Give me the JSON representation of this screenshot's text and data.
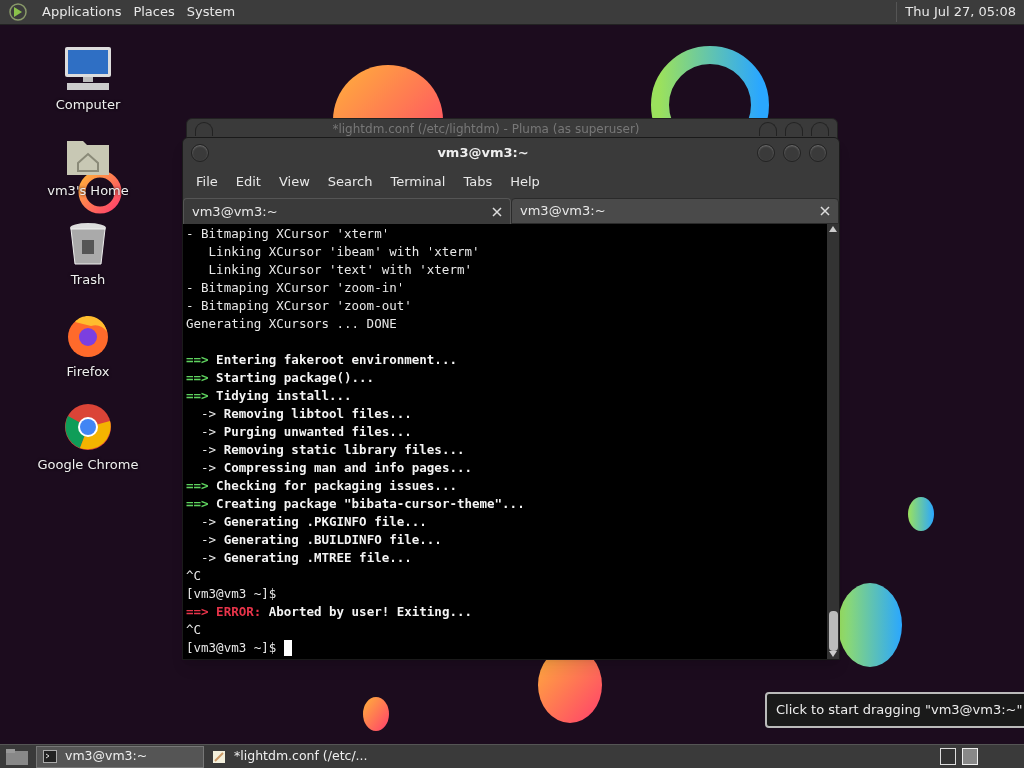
{
  "top_panel": {
    "menus": [
      "Applications",
      "Places",
      "System"
    ],
    "clock": "Thu Jul 27, 05:08"
  },
  "desktop_icons": [
    {
      "kind": "computer",
      "label": "Computer"
    },
    {
      "kind": "home",
      "label": "vm3's Home"
    },
    {
      "kind": "trash",
      "label": "Trash"
    },
    {
      "kind": "firefox",
      "label": "Firefox"
    },
    {
      "kind": "chrome",
      "label": "Google Chrome"
    }
  ],
  "background_window": {
    "title": "*lightdm.conf (/etc/lightdm) - Pluma (as superuser)"
  },
  "terminal": {
    "title": "vm3@vm3:~",
    "menu": [
      "File",
      "Edit",
      "View",
      "Search",
      "Terminal",
      "Tabs",
      "Help"
    ],
    "tabs": [
      {
        "label": "vm3@vm3:~",
        "selected": true
      },
      {
        "label": "vm3@vm3:~",
        "selected": false
      }
    ],
    "lines": [
      {
        "kind": "text",
        "segments": [
          {
            "kind": "plain",
            "text": "- Bitmaping XCursor 'xterm'"
          }
        ]
      },
      {
        "kind": "text",
        "segments": [
          {
            "kind": "plain",
            "text": "   Linking XCursor 'ibeam' with 'xterm'"
          }
        ]
      },
      {
        "kind": "text",
        "segments": [
          {
            "kind": "plain",
            "text": "   Linking XCursor 'text' with 'xterm'"
          }
        ]
      },
      {
        "kind": "text",
        "segments": [
          {
            "kind": "plain",
            "text": "- Bitmaping XCursor 'zoom-in'"
          }
        ]
      },
      {
        "kind": "text",
        "segments": [
          {
            "kind": "plain",
            "text": "- Bitmaping XCursor 'zoom-out'"
          }
        ]
      },
      {
        "kind": "text",
        "segments": [
          {
            "kind": "plain",
            "text": "Generating XCursors ... DONE"
          }
        ]
      },
      {
        "kind": "blank"
      },
      {
        "kind": "text",
        "segments": [
          {
            "kind": "marker",
            "text": "==> "
          },
          {
            "kind": "bold",
            "text": "Entering fakeroot environment..."
          }
        ]
      },
      {
        "kind": "text",
        "segments": [
          {
            "kind": "marker",
            "text": "==> "
          },
          {
            "kind": "bold",
            "text": "Starting package()..."
          }
        ]
      },
      {
        "kind": "text",
        "segments": [
          {
            "kind": "marker",
            "text": "==> "
          },
          {
            "kind": "bold",
            "text": "Tidying install..."
          }
        ]
      },
      {
        "kind": "text",
        "segments": [
          {
            "kind": "plain",
            "text": "  -> "
          },
          {
            "kind": "bold",
            "text": "Removing libtool files..."
          }
        ]
      },
      {
        "kind": "text",
        "segments": [
          {
            "kind": "plain",
            "text": "  -> "
          },
          {
            "kind": "bold",
            "text": "Purging unwanted files..."
          }
        ]
      },
      {
        "kind": "text",
        "segments": [
          {
            "kind": "plain",
            "text": "  -> "
          },
          {
            "kind": "bold",
            "text": "Removing static library files..."
          }
        ]
      },
      {
        "kind": "text",
        "segments": [
          {
            "kind": "plain",
            "text": "  -> "
          },
          {
            "kind": "bold",
            "text": "Compressing man and info pages..."
          }
        ]
      },
      {
        "kind": "text",
        "segments": [
          {
            "kind": "marker",
            "text": "==> "
          },
          {
            "kind": "bold",
            "text": "Checking for packaging issues..."
          }
        ]
      },
      {
        "kind": "text",
        "segments": [
          {
            "kind": "marker",
            "text": "==> "
          },
          {
            "kind": "bold",
            "text": "Creating package \"bibata-cursor-theme\"..."
          }
        ]
      },
      {
        "kind": "text",
        "segments": [
          {
            "kind": "plain",
            "text": "  -> "
          },
          {
            "kind": "bold",
            "text": "Generating .PKGINFO file..."
          }
        ]
      },
      {
        "kind": "text",
        "segments": [
          {
            "kind": "plain",
            "text": "  -> "
          },
          {
            "kind": "bold",
            "text": "Generating .BUILDINFO file..."
          }
        ]
      },
      {
        "kind": "text",
        "segments": [
          {
            "kind": "plain",
            "text": "  -> "
          },
          {
            "kind": "bold",
            "text": "Generating .MTREE file..."
          }
        ]
      },
      {
        "kind": "text",
        "segments": [
          {
            "kind": "plain",
            "text": "^C"
          }
        ]
      },
      {
        "kind": "text",
        "segments": [
          {
            "kind": "plain",
            "text": "[vm3@vm3 ~]$"
          }
        ]
      },
      {
        "kind": "text",
        "segments": [
          {
            "kind": "error",
            "text": "==> ERROR: "
          },
          {
            "kind": "bold",
            "text": "Aborted by user! Exiting..."
          }
        ]
      },
      {
        "kind": "text",
        "segments": [
          {
            "kind": "plain",
            "text": "^C"
          }
        ]
      },
      {
        "kind": "text",
        "segments": [
          {
            "kind": "plain",
            "text": "[vm3@vm3 ~]$ "
          },
          {
            "kind": "cursor"
          }
        ]
      }
    ]
  },
  "tooltip": "Click to start dragging \"vm3@vm3:~\"",
  "taskbar": {
    "tasks": [
      {
        "kind": "terminal",
        "label": "vm3@vm3:~",
        "selected": true
      },
      {
        "kind": "editor",
        "label": "*lightdm.conf (/etc/...",
        "selected": false
      }
    ],
    "workspaces": [
      {
        "selected": false
      },
      {
        "selected": true
      }
    ]
  }
}
